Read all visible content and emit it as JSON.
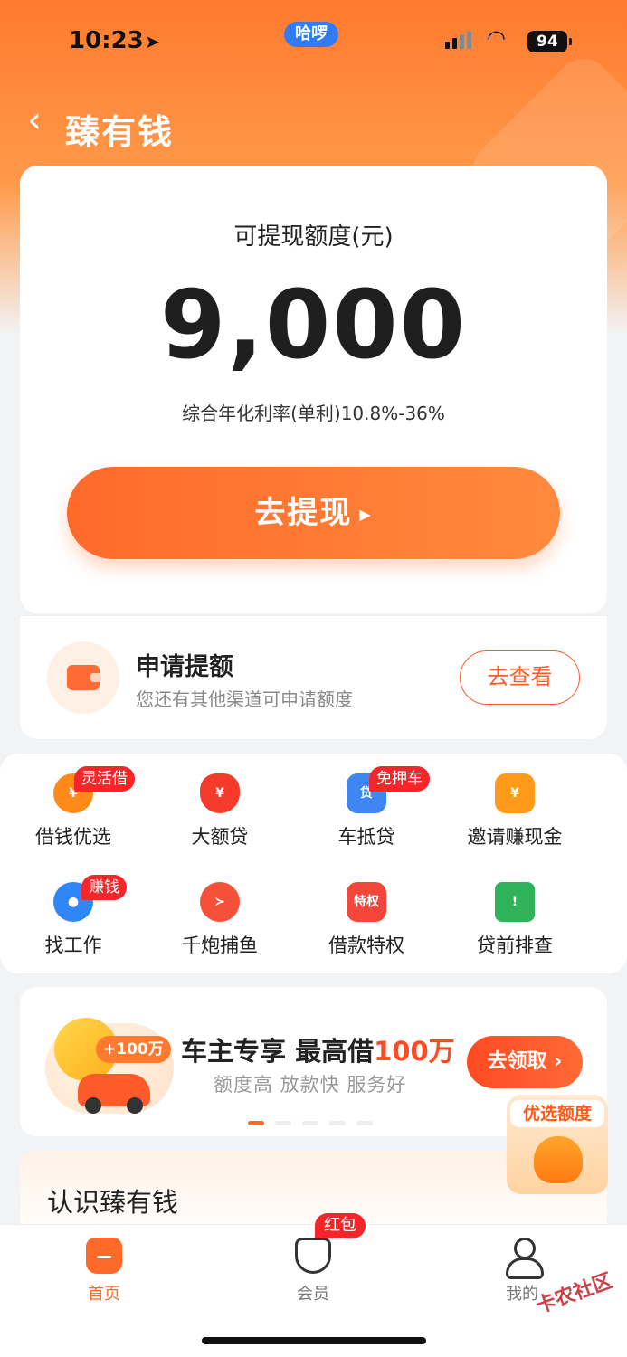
{
  "status": {
    "time": "10:23",
    "carrier_pill": "哈啰",
    "battery": "94"
  },
  "nav": {
    "back_glyph": "‹",
    "title": "臻有钱"
  },
  "card": {
    "amount_label": "可提现额度(元)",
    "amount": "9,000",
    "rate": "综合年化利率(单利)10.8%-36%",
    "withdraw_label": "去提现"
  },
  "apply": {
    "title": "申请提额",
    "subtitle": "您还有其他渠道可申请额度",
    "button": "去查看"
  },
  "services": [
    {
      "label": "借钱优选",
      "tag": "灵活借",
      "icon": "money-bag-icon",
      "color": "#ff8a1a"
    },
    {
      "label": "大额贷",
      "tag": "",
      "icon": "red-bag-icon",
      "color": "#f43b2c"
    },
    {
      "label": "车抵贷",
      "tag": "免押车",
      "icon": "car-loan-icon",
      "color": "#3f86f5"
    },
    {
      "label": "邀请赚现金",
      "tag": "",
      "icon": "invite-cash-icon",
      "color": "#ff9a1a"
    },
    {
      "label": "找工作",
      "tag": "赚钱",
      "icon": "job-search-icon",
      "color": "#2f86f6"
    },
    {
      "label": "千炮捕鱼",
      "tag": "",
      "icon": "fish-icon",
      "color": "#f4503a"
    },
    {
      "label": "借款特权",
      "tag": "",
      "icon": "privilege-icon",
      "color": "#f4463a",
      "icon_text": "特权"
    },
    {
      "label": "贷前排查",
      "tag": "",
      "icon": "warning-icon",
      "color": "#2fb25a",
      "icon_text": "!"
    }
  ],
  "banner": {
    "badge": "+100万",
    "title_prefix": "车主专享 最高借",
    "title_highlight": "100万",
    "subtitle": "额度高 放款快 服务好",
    "button": "去领取 ›",
    "page_index": 1,
    "page_count": 5
  },
  "float_promo": {
    "label": "优选额度"
  },
  "know": {
    "title": "认识臻有钱"
  },
  "tabbar": {
    "home": "首页",
    "member": "会员",
    "member_tag": "红包",
    "me": "我的"
  },
  "watermark": "卡农社区",
  "colors": {
    "accent": "#ff6a2b",
    "tag_red": "#f4262a"
  }
}
